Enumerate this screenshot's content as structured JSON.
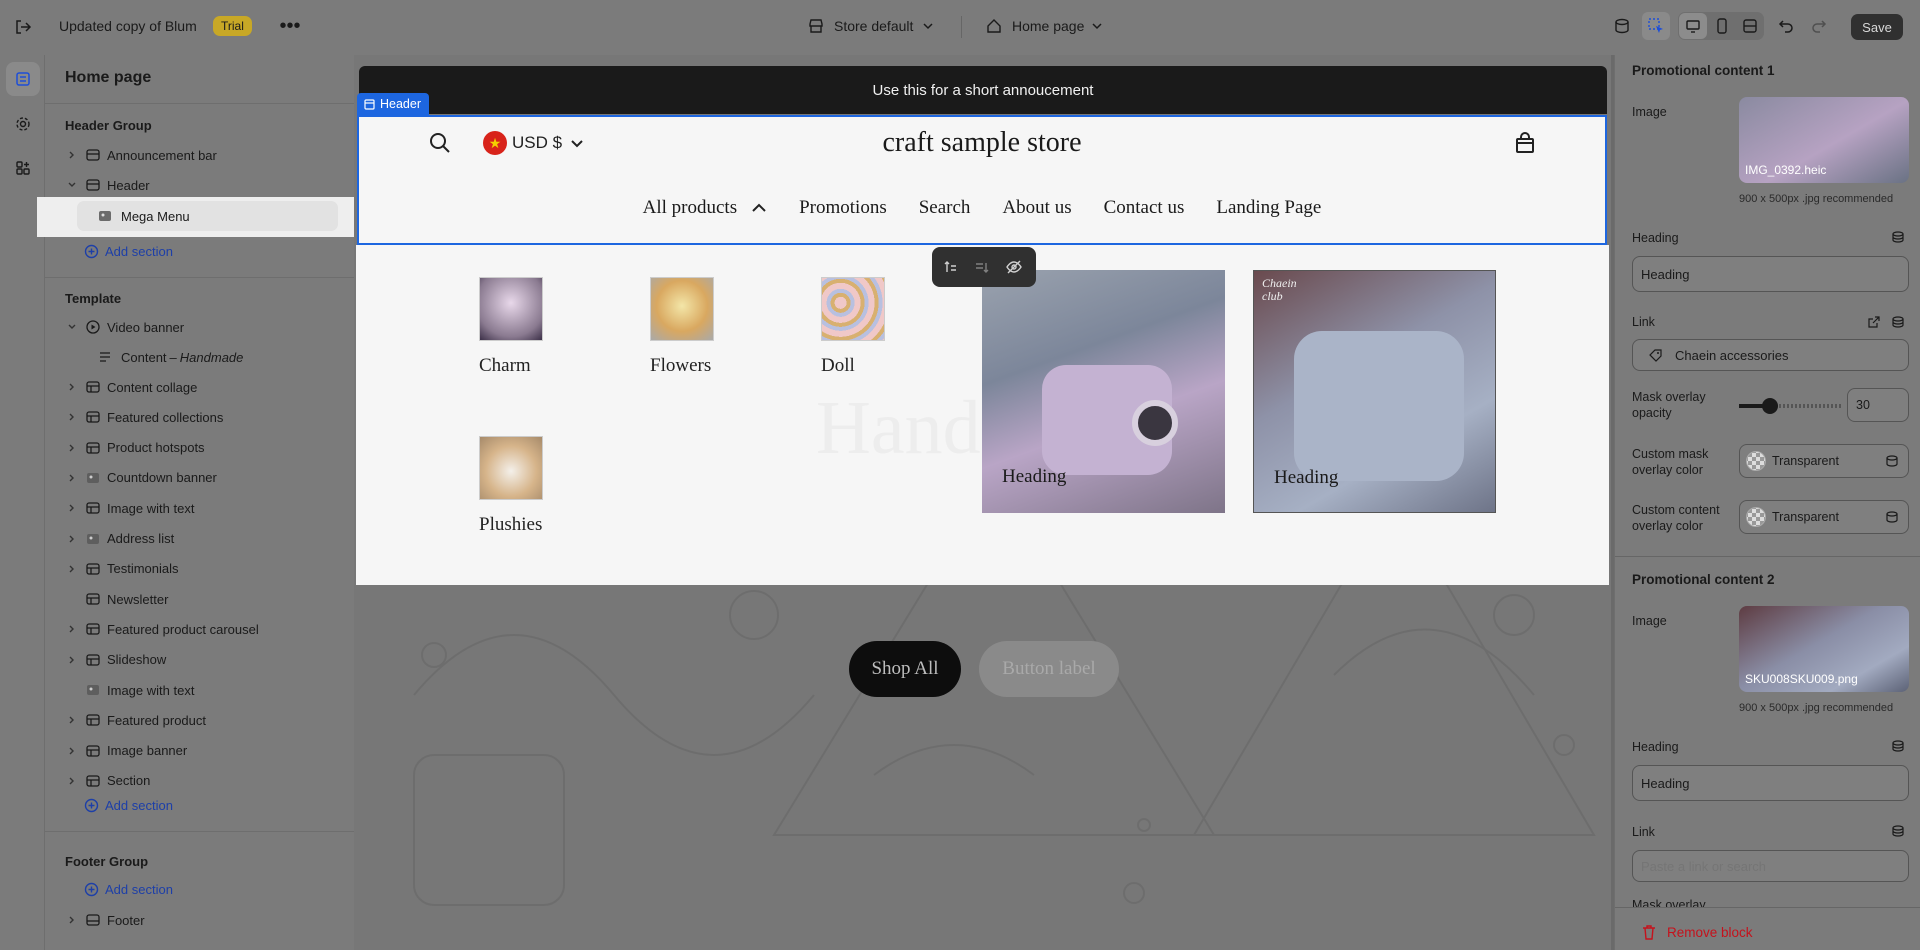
{
  "topbar": {
    "store_name": "Updated copy of Blum",
    "trial_badge": "Trial",
    "store_selector": "Store default",
    "page_selector": "Home page",
    "save_label": "Save"
  },
  "sidebar": {
    "title": "Home page",
    "header_group": {
      "title": "Header Group",
      "items": [
        "Announcement bar",
        "Header",
        "Mega Menu"
      ],
      "add_section": "Add section"
    },
    "template": {
      "title": "Template",
      "video_banner": "Video banner",
      "content_block": "Content",
      "content_block_em": "Handmade",
      "items": [
        "Content collage",
        "Featured collections",
        "Product hotspots",
        "Countdown banner",
        "Image with text",
        "Address list",
        "Testimonials",
        "Newsletter",
        "Featured product carousel",
        "Slideshow",
        "Image with text",
        "Featured product",
        "Image banner",
        "Section"
      ],
      "add_section": "Add section"
    },
    "footer_group": {
      "title": "Footer Group",
      "add_section": "Add section",
      "items": [
        "Footer"
      ]
    }
  },
  "preview": {
    "header_tag": "Header",
    "announcement": "Use this for a short annoucement",
    "currency": "USD $",
    "store_title": "craft sample store",
    "nav": [
      "All products",
      "Promotions",
      "Search",
      "About us",
      "Contact us",
      "Landing Page"
    ],
    "menu_items": [
      "Charm",
      "Flowers",
      "Doll",
      "Plushies"
    ],
    "promo_headings": [
      "Heading",
      "Heading"
    ],
    "promo_badge": "Chaein club",
    "bg_heading": "Hand",
    "buttons": [
      "Shop All",
      "Button label"
    ]
  },
  "rightpanel": {
    "promo1": {
      "title": "Promotional content 1",
      "image_label": "Image",
      "image_file": "IMG_0392.heic",
      "image_note": "900 x 500px .jpg recommended",
      "heading_label": "Heading",
      "heading_value": "Heading",
      "link_label": "Link",
      "link_value": "Chaein accessories",
      "mask_label": "Mask overlay opacity",
      "mask_value": "30",
      "mask_fraction": 0.3,
      "custom_mask_label": "Custom mask overlay color",
      "custom_mask_value": "Transparent",
      "custom_content_label": "Custom content overlay color",
      "custom_content_value": "Transparent"
    },
    "promo2": {
      "title": "Promotional content 2",
      "image_label": "Image",
      "image_file": "SKU008SKU009.png",
      "image_note": "900 x 500px .jpg recommended",
      "heading_label": "Heading",
      "heading_value": "Heading",
      "link_label": "Link",
      "link_placeholder": "Paste a link or search",
      "mask_label": "Mask overlay"
    },
    "remove_block": "Remove block"
  },
  "colors": {
    "accent_blue": "#1d66e0",
    "remove_red": "#c5121c",
    "trial_badge": "#c8a826"
  }
}
